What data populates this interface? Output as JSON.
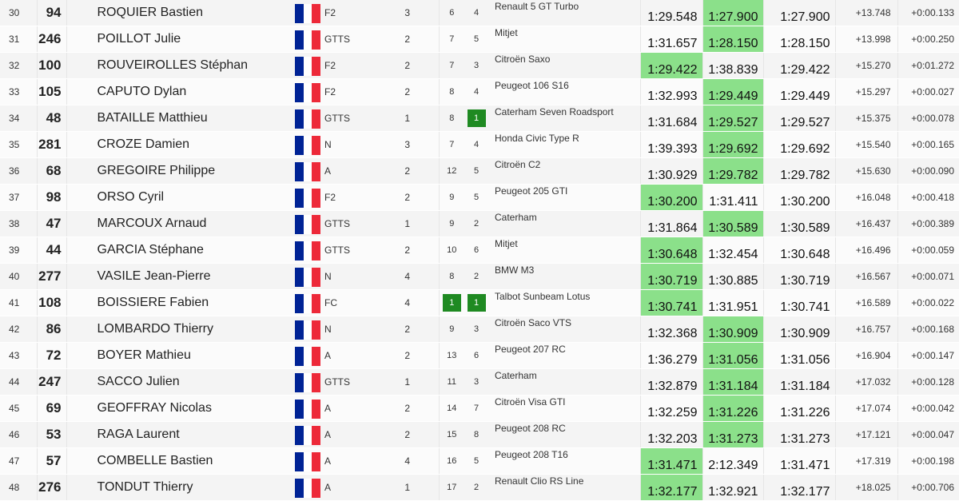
{
  "flag_colors": {
    "blue": "#002395",
    "white": "#ffffff",
    "red": "#ed2939"
  },
  "highlight_color": "#8be08a",
  "badge_color": "#1f8a22",
  "rows": [
    {
      "pos": "30",
      "num": "94",
      "name": "ROQUIER Bastien",
      "class": "F2",
      "n": "3",
      "cp": "6",
      "pc": "4",
      "car": "Renault 5 GT Turbo",
      "t1": "1:29.548",
      "t2": "1:27.900",
      "best": "1:27.900",
      "ecart": "+13.748",
      "prev": "+0:00.133",
      "hl1": false,
      "hl2": true,
      "cpBadge": false,
      "pcBadge": false
    },
    {
      "pos": "31",
      "num": "246",
      "name": "POILLOT Julie",
      "class": "GTTS",
      "n": "2",
      "cp": "7",
      "pc": "5",
      "car": "Mitjet",
      "t1": "1:31.657",
      "t2": "1:28.150",
      "best": "1:28.150",
      "ecart": "+13.998",
      "prev": "+0:00.250",
      "hl1": false,
      "hl2": true,
      "cpBadge": false,
      "pcBadge": false
    },
    {
      "pos": "32",
      "num": "100",
      "name": "ROUVEIROLLES Stéphan",
      "class": "F2",
      "n": "2",
      "cp": "7",
      "pc": "3",
      "car": "Citroën Saxo",
      "t1": "1:29.422",
      "t2": "1:38.839",
      "best": "1:29.422",
      "ecart": "+15.270",
      "prev": "+0:01.272",
      "hl1": true,
      "hl2": false,
      "cpBadge": false,
      "pcBadge": false
    },
    {
      "pos": "33",
      "num": "105",
      "name": "CAPUTO Dylan",
      "class": "F2",
      "n": "2",
      "cp": "8",
      "pc": "4",
      "car": "Peugeot 106 S16",
      "t1": "1:32.993",
      "t2": "1:29.449",
      "best": "1:29.449",
      "ecart": "+15.297",
      "prev": "+0:00.027",
      "hl1": false,
      "hl2": true,
      "cpBadge": false,
      "pcBadge": false
    },
    {
      "pos": "34",
      "num": "48",
      "name": "BATAILLE Matthieu",
      "class": "GTTS",
      "n": "1",
      "cp": "8",
      "pc": "1",
      "car": "Caterham Seven Roadsport",
      "t1": "1:31.684",
      "t2": "1:29.527",
      "best": "1:29.527",
      "ecart": "+15.375",
      "prev": "+0:00.078",
      "hl1": false,
      "hl2": true,
      "cpBadge": false,
      "pcBadge": true
    },
    {
      "pos": "35",
      "num": "281",
      "name": "CROZE Damien",
      "class": "N",
      "n": "3",
      "cp": "7",
      "pc": "4",
      "car": "Honda Civic Type R",
      "t1": "1:39.393",
      "t2": "1:29.692",
      "best": "1:29.692",
      "ecart": "+15.540",
      "prev": "+0:00.165",
      "hl1": false,
      "hl2": true,
      "cpBadge": false,
      "pcBadge": false
    },
    {
      "pos": "36",
      "num": "68",
      "name": "GREGOIRE Philippe",
      "class": "A",
      "n": "2",
      "cp": "12",
      "pc": "5",
      "car": "Citroën C2",
      "t1": "1:30.929",
      "t2": "1:29.782",
      "best": "1:29.782",
      "ecart": "+15.630",
      "prev": "+0:00.090",
      "hl1": false,
      "hl2": true,
      "cpBadge": false,
      "pcBadge": false
    },
    {
      "pos": "37",
      "num": "98",
      "name": "ORSO Cyril",
      "class": "F2",
      "n": "2",
      "cp": "9",
      "pc": "5",
      "car": "Peugeot 205 GTI",
      "t1": "1:30.200",
      "t2": "1:31.411",
      "best": "1:30.200",
      "ecart": "+16.048",
      "prev": "+0:00.418",
      "hl1": true,
      "hl2": false,
      "cpBadge": false,
      "pcBadge": false
    },
    {
      "pos": "38",
      "num": "47",
      "name": "MARCOUX Arnaud",
      "class": "GTTS",
      "n": "1",
      "cp": "9",
      "pc": "2",
      "car": "Caterham",
      "t1": "1:31.864",
      "t2": "1:30.589",
      "best": "1:30.589",
      "ecart": "+16.437",
      "prev": "+0:00.389",
      "hl1": false,
      "hl2": true,
      "cpBadge": false,
      "pcBadge": false
    },
    {
      "pos": "39",
      "num": "44",
      "name": "GARCIA Stéphane",
      "class": "GTTS",
      "n": "2",
      "cp": "10",
      "pc": "6",
      "car": "Mitjet",
      "t1": "1:30.648",
      "t2": "1:32.454",
      "best": "1:30.648",
      "ecart": "+16.496",
      "prev": "+0:00.059",
      "hl1": true,
      "hl2": false,
      "cpBadge": false,
      "pcBadge": false
    },
    {
      "pos": "40",
      "num": "277",
      "name": "VASILE Jean-Pierre",
      "class": "N",
      "n": "4",
      "cp": "8",
      "pc": "2",
      "car": "BMW M3",
      "t1": "1:30.719",
      "t2": "1:30.885",
      "best": "1:30.719",
      "ecart": "+16.567",
      "prev": "+0:00.071",
      "hl1": true,
      "hl2": false,
      "cpBadge": false,
      "pcBadge": false
    },
    {
      "pos": "41",
      "num": "108",
      "name": "BOISSIERE Fabien",
      "class": "FC",
      "n": "4",
      "cp": "1",
      "pc": "1",
      "car": "Talbot Sunbeam Lotus",
      "t1": "1:30.741",
      "t2": "1:31.951",
      "best": "1:30.741",
      "ecart": "+16.589",
      "prev": "+0:00.022",
      "hl1": true,
      "hl2": false,
      "cpBadge": true,
      "pcBadge": true
    },
    {
      "pos": "42",
      "num": "86",
      "name": "LOMBARDO Thierry",
      "class": "N",
      "n": "2",
      "cp": "9",
      "pc": "3",
      "car": "Citroën Saco VTS",
      "t1": "1:32.368",
      "t2": "1:30.909",
      "best": "1:30.909",
      "ecart": "+16.757",
      "prev": "+0:00.168",
      "hl1": false,
      "hl2": true,
      "cpBadge": false,
      "pcBadge": false
    },
    {
      "pos": "43",
      "num": "72",
      "name": "BOYER Mathieu",
      "class": "A",
      "n": "2",
      "cp": "13",
      "pc": "6",
      "car": "Peugeot 207 RC",
      "t1": "1:36.279",
      "t2": "1:31.056",
      "best": "1:31.056",
      "ecart": "+16.904",
      "prev": "+0:00.147",
      "hl1": false,
      "hl2": true,
      "cpBadge": false,
      "pcBadge": false
    },
    {
      "pos": "44",
      "num": "247",
      "name": "SACCO Julien",
      "class": "GTTS",
      "n": "1",
      "cp": "11",
      "pc": "3",
      "car": "Caterham",
      "t1": "1:32.879",
      "t2": "1:31.184",
      "best": "1:31.184",
      "ecart": "+17.032",
      "prev": "+0:00.128",
      "hl1": false,
      "hl2": true,
      "cpBadge": false,
      "pcBadge": false
    },
    {
      "pos": "45",
      "num": "69",
      "name": "GEOFFRAY Nicolas",
      "class": "A",
      "n": "2",
      "cp": "14",
      "pc": "7",
      "car": "Citroën Visa GTI",
      "t1": "1:32.259",
      "t2": "1:31.226",
      "best": "1:31.226",
      "ecart": "+17.074",
      "prev": "+0:00.042",
      "hl1": false,
      "hl2": true,
      "cpBadge": false,
      "pcBadge": false
    },
    {
      "pos": "46",
      "num": "53",
      "name": "RAGA Laurent",
      "class": "A",
      "n": "2",
      "cp": "15",
      "pc": "8",
      "car": "Peugeot 208 RC",
      "t1": "1:32.203",
      "t2": "1:31.273",
      "best": "1:31.273",
      "ecart": "+17.121",
      "prev": "+0:00.047",
      "hl1": false,
      "hl2": true,
      "cpBadge": false,
      "pcBadge": false
    },
    {
      "pos": "47",
      "num": "57",
      "name": "COMBELLE Bastien",
      "class": "A",
      "n": "4",
      "cp": "16",
      "pc": "5",
      "car": "Peugeot 208 T16",
      "t1": "1:31.471",
      "t2": "2:12.349",
      "best": "1:31.471",
      "ecart": "+17.319",
      "prev": "+0:00.198",
      "hl1": true,
      "hl2": false,
      "cpBadge": false,
      "pcBadge": false
    },
    {
      "pos": "48",
      "num": "276",
      "name": "TONDUT Thierry",
      "class": "A",
      "n": "1",
      "cp": "17",
      "pc": "2",
      "car": "Renault Clio RS Line",
      "t1": "1:32.177",
      "t2": "1:32.921",
      "best": "1:32.177",
      "ecart": "+18.025",
      "prev": "+0:00.706",
      "hl1": true,
      "hl2": false,
      "cpBadge": false,
      "pcBadge": false
    }
  ]
}
